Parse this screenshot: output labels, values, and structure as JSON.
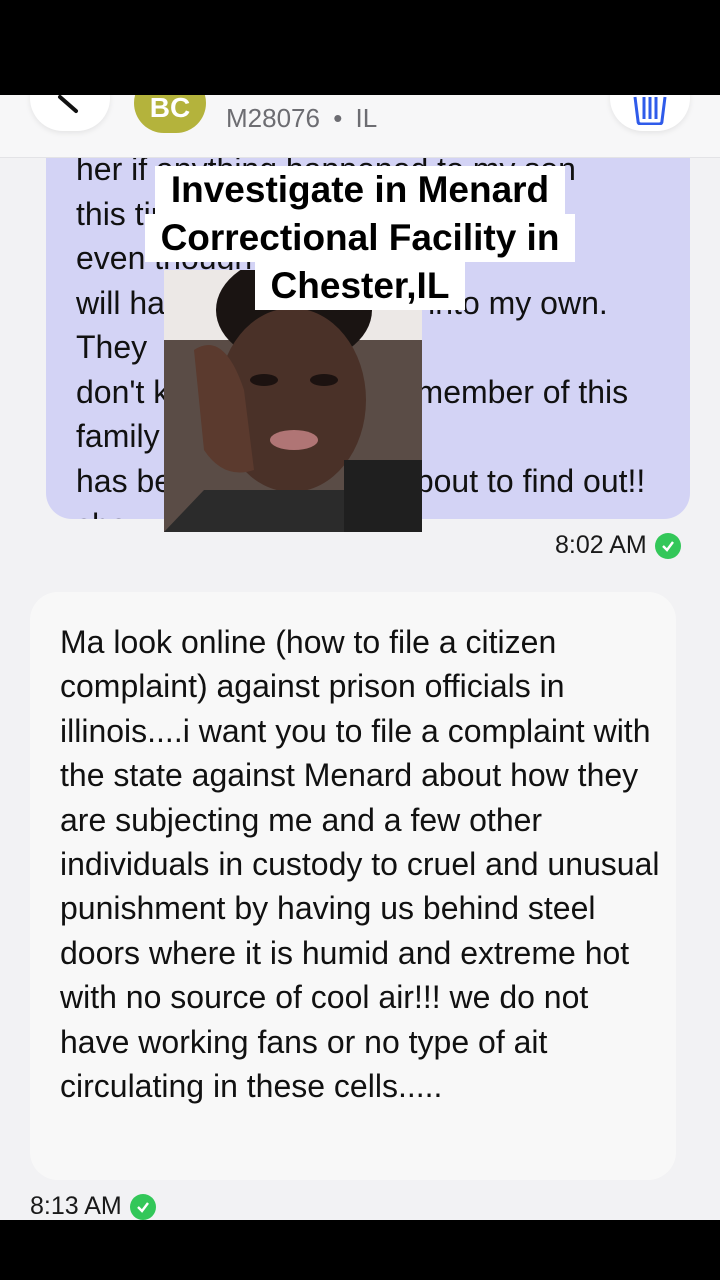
{
  "header": {
    "avatar_initials": "BC",
    "contact_id": "M28076",
    "separator": "•",
    "state": "IL",
    "back_icon": "chevron-left-icon",
    "trash_icon": "trash-icon"
  },
  "overlay": {
    "caption_lines": [
      "Investigate in Menard",
      "Correctional Facility in",
      "Chester,IL"
    ]
  },
  "messages": {
    "sent": {
      "text": "her if anything happened to my son\nthis time\neven though I told her you I\nwill have to take matters into my own. They\ndon't know what kind of member of this family\nhas been doing that is about to find out!! she\nsaid the investigating should be done\ntoday",
      "time": "8:02 AM",
      "status_icon": "delivered-check-icon",
      "status_color": "#33c759"
    },
    "received": {
      "text": "Ma look online (how to file a citizen complaint) against prison officials in illinois....i want you to file a complaint with the state against Menard about how they are subjecting me and a few other individuals in custody to cruel and unusual punishment by having us behind steel doors where it is humid and extreme hot with no source of cool air!!! we do not have working fans or no type of ait circulating in these cells.....",
      "time": "8:13 AM",
      "status_icon": "delivered-check-icon"
    }
  },
  "colors": {
    "sent_bubble": "#d3d3f5",
    "received_bubble": "#f8f8f8",
    "avatar": "#b4b33c",
    "trash_accent": "#2f5bea"
  }
}
